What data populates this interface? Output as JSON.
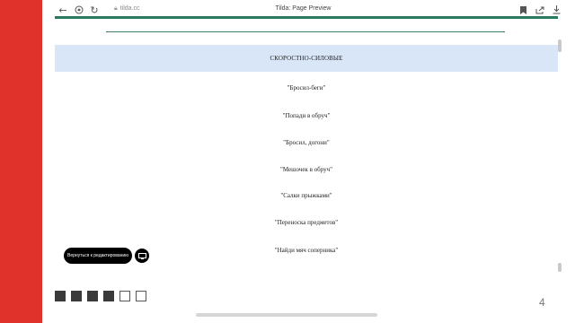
{
  "browser": {
    "url": "tilda.cc",
    "title": "Tilda: Page Preview"
  },
  "content": {
    "section_heading": "СКОРОСТНО-СИЛОВЫЕ",
    "items": [
      "\"Бросил-беги\"",
      "\"Попади в обруч\"",
      "\"Бросил, догони\"",
      "\"Мешочек в обруч\"",
      "\"Салки прыжками\"",
      "\"Переноска предметов\"",
      "\"Найди мяч соперника\""
    ]
  },
  "editor": {
    "back_label": "Вернуться к редактированию"
  },
  "slides": {
    "squares": [
      "filled",
      "filled",
      "filled",
      "filled",
      "empty",
      "empty"
    ],
    "page_number": "4"
  },
  "colors": {
    "accent_red": "#e0322a",
    "header_line_green": "#2a7a60",
    "section_bg": "#d8e6f8"
  }
}
